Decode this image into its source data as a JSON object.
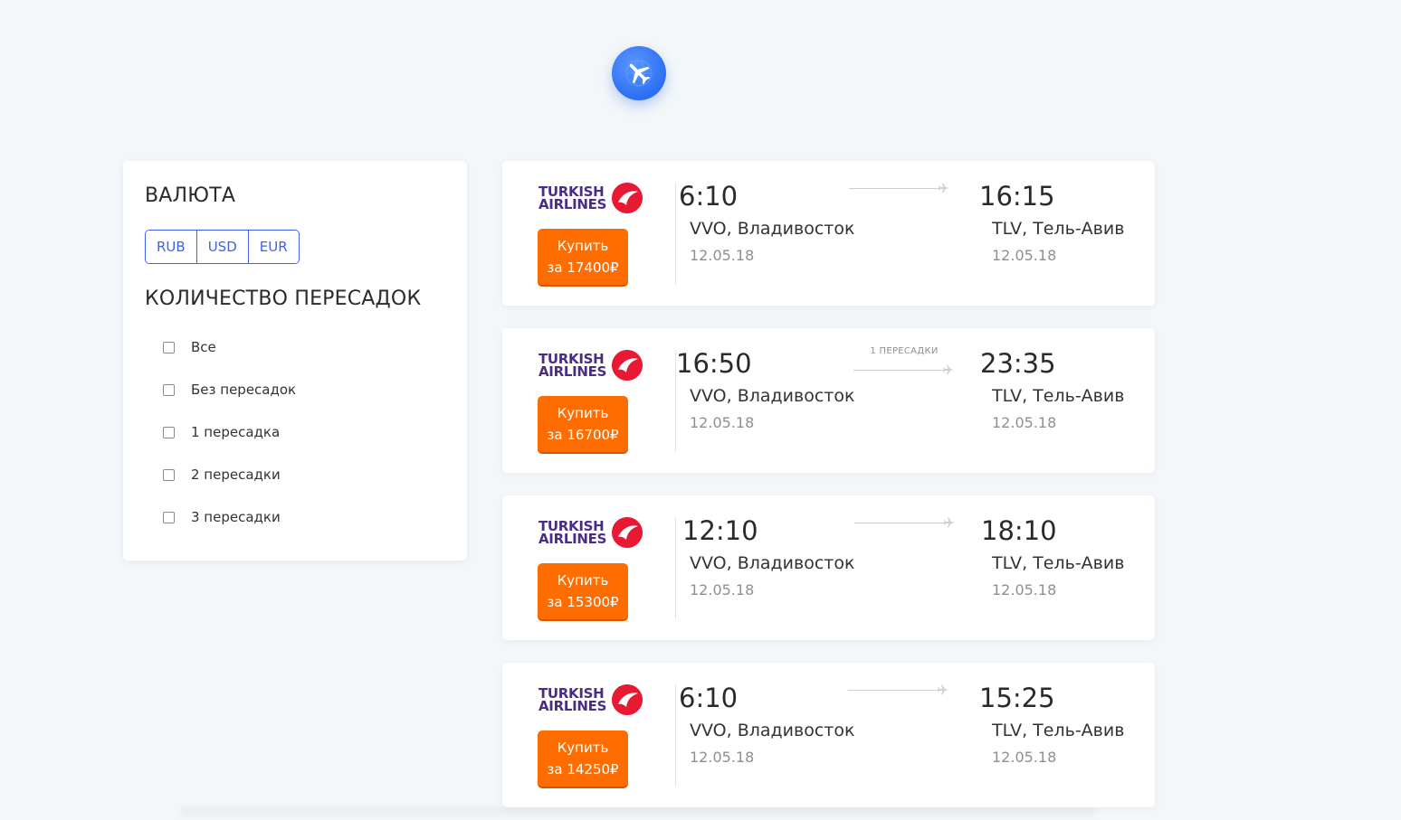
{
  "brand": {
    "logo_icon": "plane-globe-icon",
    "accent": "#2d6ff3"
  },
  "filters": {
    "currency_title": "ВАЛЮТА",
    "currencies": [
      "RUB",
      "USD",
      "EUR"
    ],
    "stops_title": "КОЛИЧЕСТВО ПЕРЕСАДОК",
    "stop_options": [
      "Все",
      "Без пересадок",
      "1 пересадка",
      "2 пересадки",
      "3 пересадки"
    ]
  },
  "colors": {
    "buy_button": "#ff6d00",
    "currency_border": "#3f62e8",
    "airline_text": "#4a2c86",
    "airline_logo": "#e81932"
  },
  "tickets": [
    {
      "airline_line1": "TURKISH",
      "airline_line2": "AIRLINES",
      "buy_line1": "Купить",
      "buy_line2": "за 17400₽",
      "dep_time": "6:10",
      "dep_city": "VVO, Владивосток",
      "dep_date": "12.05.18",
      "stops": "",
      "arr_time": "16:15",
      "arr_city": "TLV, Тель-Авив",
      "arr_date": "12.05.18"
    },
    {
      "airline_line1": "TURKISH",
      "airline_line2": "AIRLINES",
      "buy_line1": "Купить",
      "buy_line2": "за 16700₽",
      "dep_time": "16:50",
      "dep_city": "VVO, Владивосток",
      "dep_date": "12.05.18",
      "stops": "1 ПЕРЕСАДКИ",
      "arr_time": "23:35",
      "arr_city": "TLV, Тель-Авив",
      "arr_date": "12.05.18"
    },
    {
      "airline_line1": "TURKISH",
      "airline_line2": "AIRLINES",
      "buy_line1": "Купить",
      "buy_line2": "за 15300₽",
      "dep_time": "12:10",
      "dep_city": "VVO, Владивосток",
      "dep_date": "12.05.18",
      "stops": "",
      "arr_time": "18:10",
      "arr_city": "TLV, Тель-Авив",
      "arr_date": "12.05.18"
    },
    {
      "airline_line1": "TURKISH",
      "airline_line2": "AIRLINES",
      "buy_line1": "Купить",
      "buy_line2": "за 14250₽",
      "dep_time": "6:10",
      "dep_city": "VVO, Владивосток",
      "dep_date": "12.05.18",
      "stops": "",
      "arr_time": "15:25",
      "arr_city": "TLV, Тель-Авив",
      "arr_date": "12.05.18"
    }
  ]
}
